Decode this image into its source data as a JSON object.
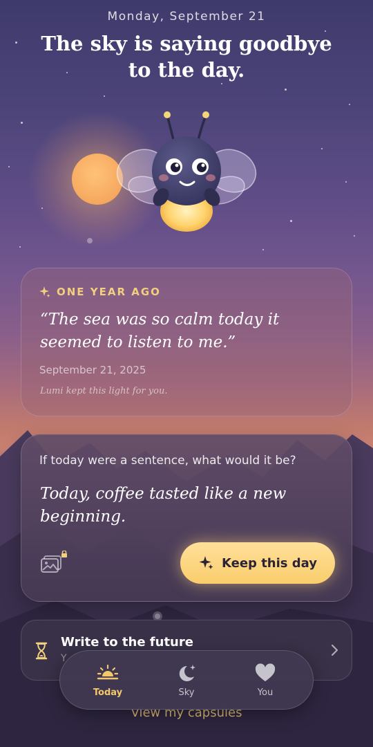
{
  "header": {
    "date": "Monday, September 21",
    "headline": "The sky is saying goodbye to the day."
  },
  "memory": {
    "eyebrow": "ONE YEAR AGO",
    "quote": "“The sea was so calm today it seemed to listen to me.”",
    "date": "September 21, 2025",
    "note": "Lumi kept this light for you."
  },
  "prompt": {
    "question": "If today were a sentence, what would it be?",
    "answer": "Today, coffee tasted like a new beginning.",
    "keep_label": "Keep this day"
  },
  "future": {
    "title": "Write to the future",
    "subtitle": "Y"
  },
  "capsules_link": "View my capsules",
  "tabs": [
    {
      "label": "Today",
      "icon": "sunset-icon",
      "active": true
    },
    {
      "label": "Sky",
      "icon": "moon-stars-icon",
      "active": false
    },
    {
      "label": "You",
      "icon": "heart-icon",
      "active": false
    }
  ],
  "colors": {
    "accent": "#f3c86a",
    "button": "#f9cd6c",
    "eyebrow": "#f2cf7e"
  }
}
